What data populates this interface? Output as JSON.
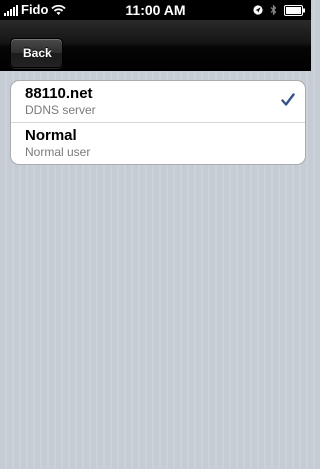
{
  "status_bar": {
    "carrier": "Fido",
    "time": "11:00 AM",
    "icons": [
      "signal-icon",
      "wifi-icon",
      "location-icon",
      "bluetooth-icon",
      "battery-icon"
    ]
  },
  "nav": {
    "back_label": "Back"
  },
  "list": {
    "items": [
      {
        "title": "88110.net",
        "subtitle": "DDNS server",
        "selected": true
      },
      {
        "title": "Normal",
        "subtitle": "Normal user",
        "selected": false
      }
    ]
  },
  "colors": {
    "checkmark": "#385487",
    "background": "#c5ccd4",
    "subtitle": "#7a7a7a"
  }
}
